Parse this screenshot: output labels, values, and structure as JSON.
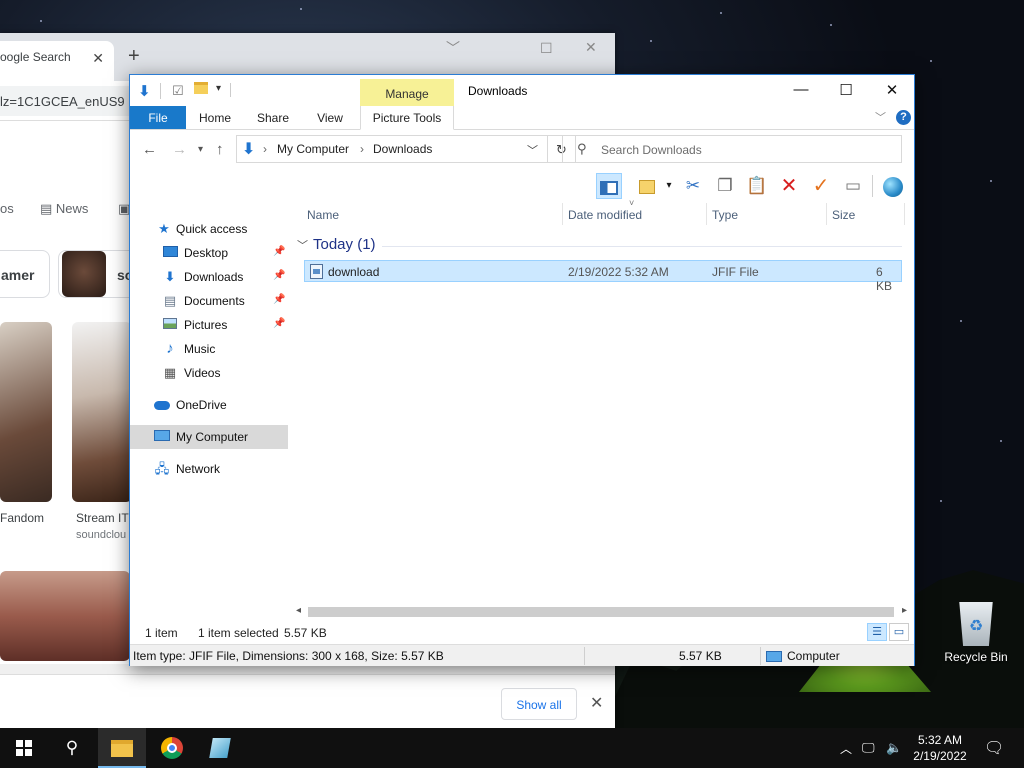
{
  "chrome": {
    "tab_title": "oogle Search",
    "url_fragment": "lz=1C1GCEA_enUS9",
    "filters": [
      "os",
      "News"
    ],
    "chips": [
      "amer",
      "so"
    ],
    "captions": [
      {
        "title": "Fandom",
        "sub": ""
      },
      {
        "title": "Stream IT",
        "sub": "soundclou"
      }
    ],
    "download_bar": {
      "show_all": "Show all"
    }
  },
  "explorer": {
    "title": "Downloads",
    "manage_label": "Manage",
    "ribbon_tabs": [
      "File",
      "Home",
      "Share",
      "View",
      "Picture Tools"
    ],
    "address": {
      "segments": [
        "My Computer",
        "Downloads"
      ]
    },
    "search_placeholder": "Search Downloads",
    "nav_items": [
      {
        "label": "Quick access",
        "icon": "star-icon",
        "pinned": false
      },
      {
        "label": "Desktop",
        "icon": "desktop-icon",
        "pinned": true
      },
      {
        "label": "Downloads",
        "icon": "download-arrow-icon",
        "pinned": true
      },
      {
        "label": "Documents",
        "icon": "document-icon",
        "pinned": true
      },
      {
        "label": "Pictures",
        "icon": "picture-icon",
        "pinned": true
      },
      {
        "label": "Music",
        "icon": "music-note-icon",
        "pinned": false
      },
      {
        "label": "Videos",
        "icon": "film-icon",
        "pinned": false
      },
      {
        "label": "OneDrive",
        "icon": "cloud-icon",
        "pinned": false
      },
      {
        "label": "My Computer",
        "icon": "computer-icon",
        "pinned": false,
        "selected": true
      },
      {
        "label": "Network",
        "icon": "network-icon",
        "pinned": false
      }
    ],
    "columns": [
      "Name",
      "Date modified",
      "Type",
      "Size"
    ],
    "group": {
      "label": "Today (1)"
    },
    "files": [
      {
        "name": "download",
        "date": "2/19/2022 5:32 AM",
        "type": "JFIF File",
        "size": "6 KB"
      }
    ],
    "status": {
      "count": "1 item",
      "selected": "1 item selected",
      "size": "5.57 KB"
    },
    "details": {
      "info": "Item type: JFIF File, Dimensions: 300 x 168, Size: 5.57 KB",
      "size": "5.57 KB",
      "location": "Computer"
    }
  },
  "desktop": {
    "recycle_bin": "Recycle Bin"
  },
  "taskbar": {
    "time": "5:32 AM",
    "date": "2/19/2022"
  }
}
